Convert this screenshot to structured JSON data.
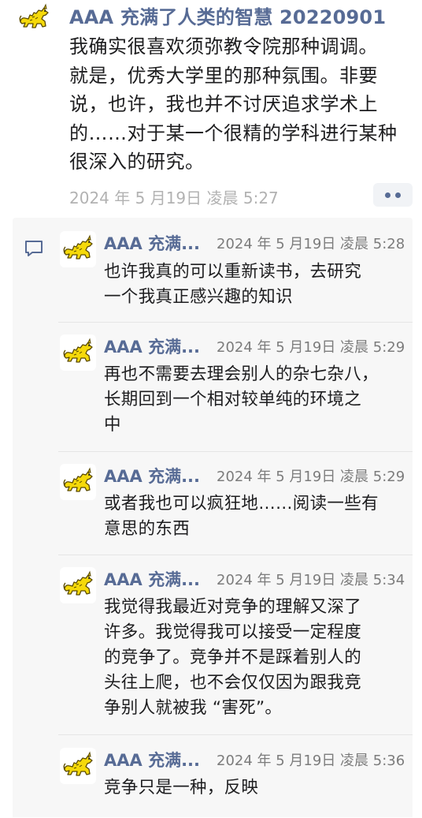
{
  "post": {
    "avatar": "cat-avatar-icon",
    "author": "AAA 充满了人类的智慧 20220901",
    "lines": [
      "我确实很喜欢须弥教令院那种调调。",
      "就是，优秀大学里的那种氛围。非要",
      "说，也许，我也并不讨厌追求学术上",
      "的……对于某一个很精的学科进行某种",
      "很深入的研究。"
    ],
    "time": "2024 年 5 月19日 凌晨 5:27",
    "more_icon": "more-dots-icon"
  },
  "comments_icon": "comment-bubble-icon",
  "comments": [
    {
      "author": "AAA 充满...",
      "time": "2024 年 5 月19日 凌晨 5:28",
      "lines": [
        "也许我真的可以重新读书，去研究",
        "一个我真正感兴趣的知识"
      ]
    },
    {
      "author": "AAA 充满...",
      "time": "2024 年 5 月19日 凌晨 5:29",
      "lines": [
        "再也不需要去理会别人的杂七杂八，",
        "长期回到一个相对较单纯的环境之",
        "中"
      ]
    },
    {
      "author": "AAA 充满...",
      "time": "2024 年 5 月19日 凌晨 5:29",
      "lines": [
        "或者我也可以疯狂地……阅读一些有",
        "意思的东西"
      ]
    },
    {
      "author": "AAA 充满...",
      "time": "2024 年 5 月19日 凌晨 5:34",
      "lines": [
        "我觉得我最近对竞争的理解又深了",
        "许多。我觉得我可以接受一定程度",
        "的竞争了。竞争并不是踩着别人的",
        "头往上爬，也不会仅仅因为跟我竞",
        "争别人就被我 “害死”。"
      ]
    },
    {
      "author": "AAA 充满...",
      "time": "2024 年 5 月19日 凌晨 5:36",
      "lines": [
        "竞争只是一种，反映"
      ]
    }
  ],
  "colors": {
    "link_blue": "#576b95",
    "panel_bg": "#f7f7f7",
    "avatar_cat": "#f5d90a"
  }
}
